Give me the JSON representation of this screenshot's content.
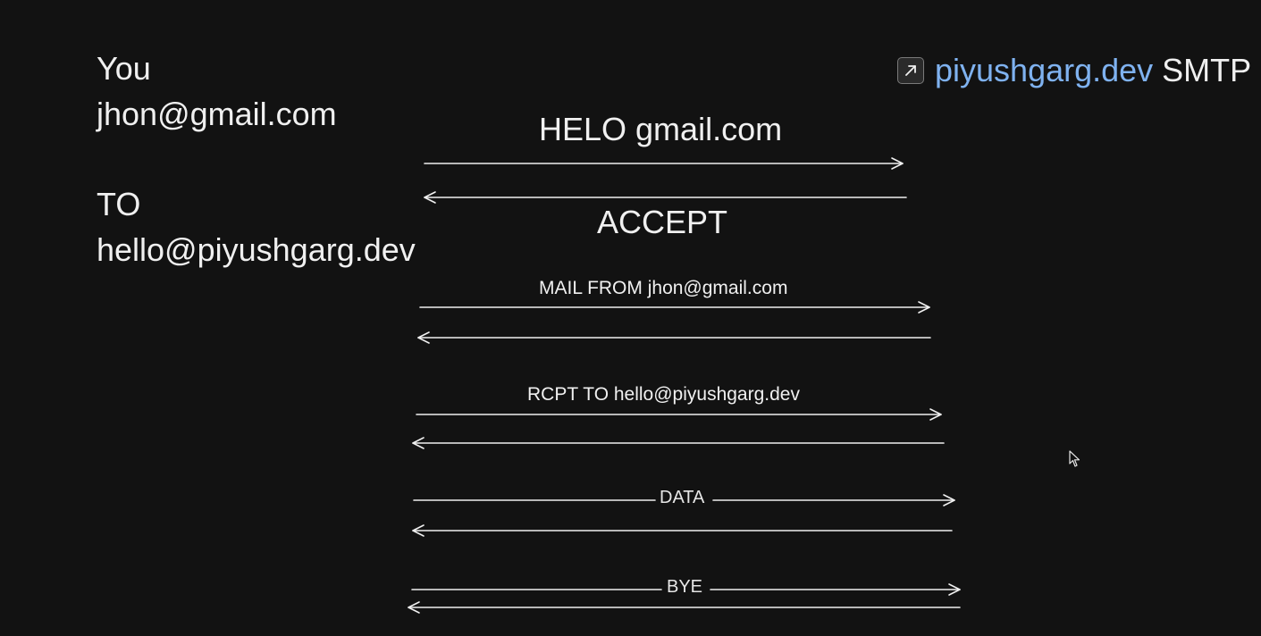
{
  "client": {
    "label": "You",
    "email": "jhon@gmail.com",
    "to_label": "TO",
    "to_email": "hello@piyushgarg.dev"
  },
  "server": {
    "icon": "external-link-icon",
    "host": "piyushgarg.dev",
    "protocol": "SMTP",
    "host_color": "#7fb2f0"
  },
  "messages": {
    "helo": "HELO gmail.com",
    "accept": "ACCEPT",
    "mail_from": "MAIL FROM jhon@gmail.com",
    "rcpt_to": "RCPT TO hello@piyushgarg.dev",
    "data": "DATA",
    "bye": "BYE"
  },
  "colors": {
    "background": "#121212",
    "foreground": "#f0f0f0"
  }
}
